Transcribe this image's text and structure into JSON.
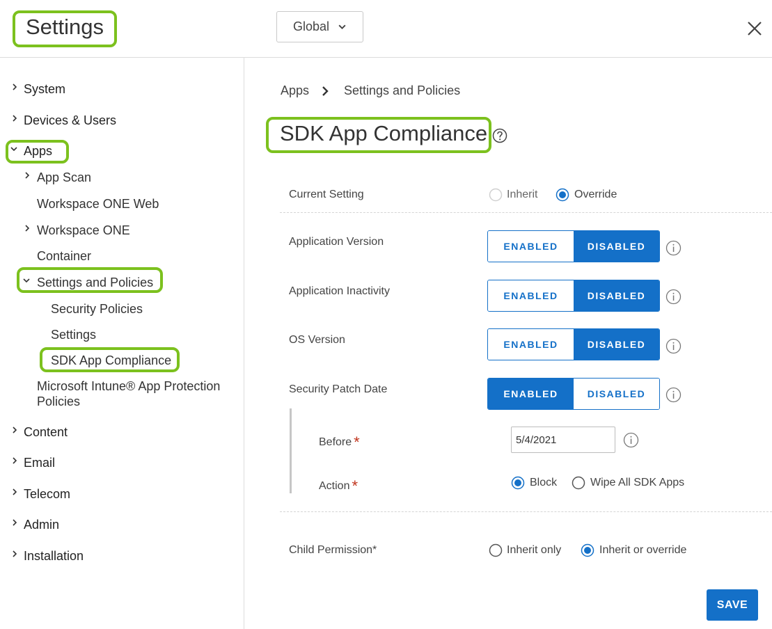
{
  "header": {
    "title": "Settings",
    "scope_value": "Global",
    "close_icon": "close-icon"
  },
  "colors": {
    "accent": "#1470c8",
    "highlight": "#7cc11e",
    "required": "#c0341d"
  },
  "sidebar": {
    "system": "System",
    "devices_users": "Devices & Users",
    "apps": "Apps",
    "app_scan": "App Scan",
    "workspace_one_web": "Workspace ONE Web",
    "workspace_one": "Workspace ONE",
    "container": "Container",
    "settings_and_policies": "Settings and Policies",
    "security_policies": "Security Policies",
    "settings": "Settings",
    "sdk_app_compliance": "SDK App Compliance",
    "intune_line1": "Microsoft Intune® App Protection",
    "intune_line2": "Policies",
    "content": "Content",
    "email": "Email",
    "telecom": "Telecom",
    "admin": "Admin",
    "installation": "Installation"
  },
  "main": {
    "breadcrumb": [
      "Apps",
      "Settings and Policies"
    ],
    "title": "SDK App Compliance",
    "current_setting": {
      "label": "Current Setting",
      "options": [
        "Inherit",
        "Override"
      ],
      "selected": "Override"
    },
    "toggles": [
      {
        "label": "Application Version",
        "enabled": "ENABLED",
        "disabled": "DISABLED",
        "state": "disabled"
      },
      {
        "label": "Application Inactivity",
        "enabled": "ENABLED",
        "disabled": "DISABLED",
        "state": "disabled"
      },
      {
        "label": "OS Version",
        "enabled": "ENABLED",
        "disabled": "DISABLED",
        "state": "disabled"
      },
      {
        "label": "Security Patch Date",
        "enabled": "ENABLED",
        "disabled": "DISABLED",
        "state": "enabled"
      }
    ],
    "before": {
      "label": "Before",
      "required": "*",
      "value": "5/4/2021"
    },
    "action": {
      "label": "Action",
      "required": "*",
      "options": [
        "Block",
        "Wipe All SDK Apps"
      ],
      "selected": "Block"
    },
    "child_permission": {
      "label": "Child Permission*",
      "options": [
        "Inherit only",
        "Inherit or override"
      ],
      "selected": "Inherit or override"
    },
    "save_label": "SAVE"
  }
}
